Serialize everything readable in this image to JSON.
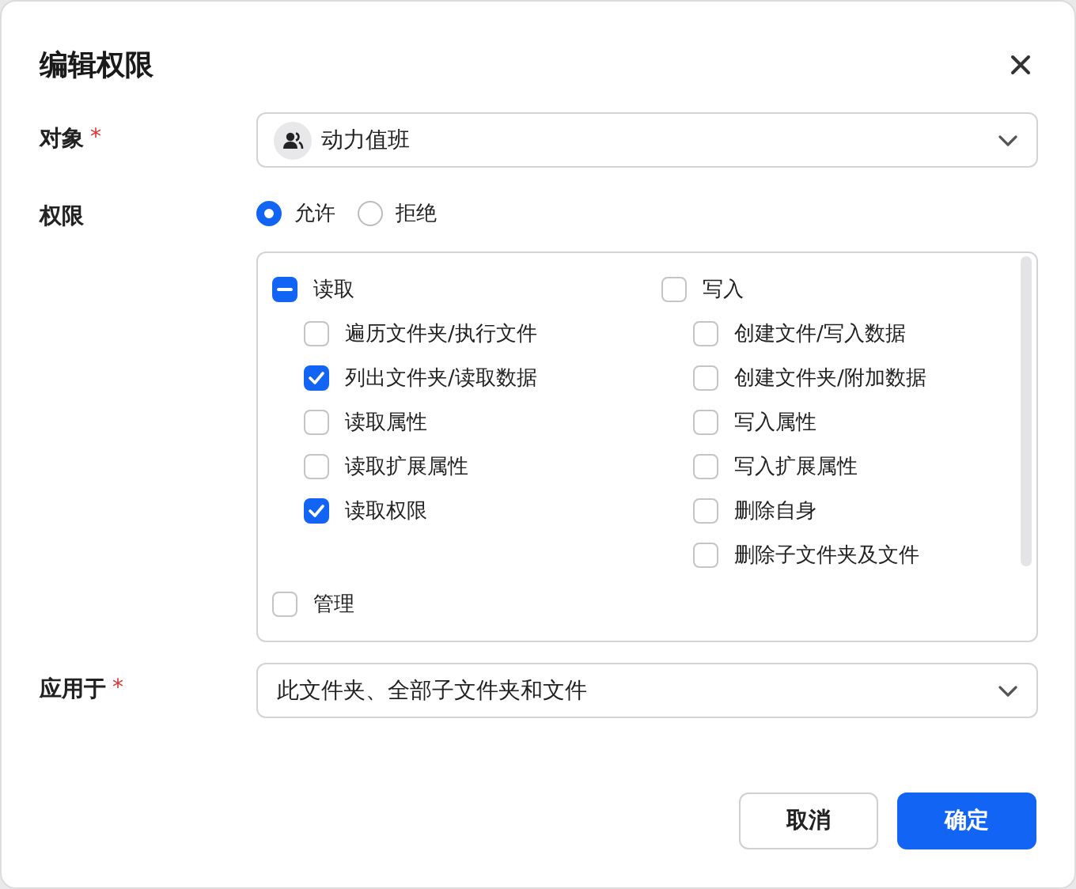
{
  "dialog": {
    "title": "编辑权限"
  },
  "target": {
    "label": "对象",
    "required_mark": "*",
    "value": "动力值班"
  },
  "permission": {
    "label": "权限",
    "options": [
      {
        "label": "允许",
        "selected": true
      },
      {
        "label": "拒绝",
        "selected": false
      }
    ]
  },
  "groups": [
    {
      "label": "读取",
      "checked": false,
      "indeterminate": true,
      "children": [
        {
          "label": "遍历文件夹/执行文件",
          "checked": false
        },
        {
          "label": "列出文件夹/读取数据",
          "checked": true
        },
        {
          "label": "读取属性",
          "checked": false
        },
        {
          "label": "读取扩展属性",
          "checked": false
        },
        {
          "label": "读取权限",
          "checked": true
        }
      ]
    },
    {
      "label": "写入",
      "checked": false,
      "indeterminate": false,
      "children": [
        {
          "label": "创建文件/写入数据",
          "checked": false
        },
        {
          "label": "创建文件夹/附加数据",
          "checked": false
        },
        {
          "label": "写入属性",
          "checked": false
        },
        {
          "label": "写入扩展属性",
          "checked": false
        },
        {
          "label": "删除自身",
          "checked": false
        },
        {
          "label": "删除子文件夹及文件",
          "checked": false
        }
      ]
    },
    {
      "label": "管理",
      "checked": false,
      "indeterminate": false
    }
  ],
  "apply_to": {
    "label": "应用于",
    "required_mark": "*",
    "value": "此文件夹、全部子文件夹和文件"
  },
  "buttons": [
    {
      "label": "取消",
      "kind": "secondary"
    },
    {
      "label": "确定",
      "kind": "primary"
    }
  ]
}
